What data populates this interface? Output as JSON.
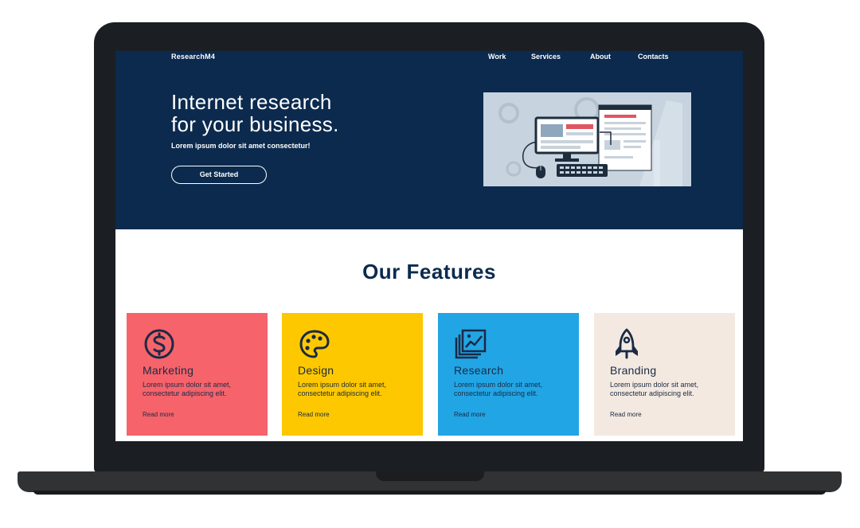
{
  "brand": "ResearchM4",
  "nav": [
    "Work",
    "Services",
    "About",
    "Contacts"
  ],
  "hero": {
    "title_line1": "Internet research",
    "title_line2": "for your business.",
    "subtitle": "Lorem ipsum dolor sit amet consectetur!",
    "cta": "Get Started"
  },
  "features": {
    "title": "Our Features",
    "cards": [
      {
        "title": "Marketing",
        "description": "Lorem ipsum dolor sit amet, consectetur adipiscing elit.",
        "link": "Read more",
        "icon": "dollar-coin-icon",
        "color": "#f6636b"
      },
      {
        "title": "Design",
        "description": "Lorem ipsum dolor sit amet, consectetur adipiscing elit.",
        "link": "Read more",
        "icon": "palette-icon",
        "color": "#fdc800"
      },
      {
        "title": "Research",
        "description": "Lorem ipsum dolor sit amet, consectetur adipiscing elit.",
        "link": "Read more",
        "icon": "chart-image-icon",
        "color": "#22a5e4"
      },
      {
        "title": "Branding",
        "description": "Lorem ipsum dolor sit amet, consectetur adipiscing elit.",
        "link": "Read more",
        "icon": "rocket-icon",
        "color": "#f3e9e0"
      }
    ]
  },
  "colors": {
    "hero_bg": "#0b2a4e",
    "laptop_frame": "#1b1f23"
  }
}
